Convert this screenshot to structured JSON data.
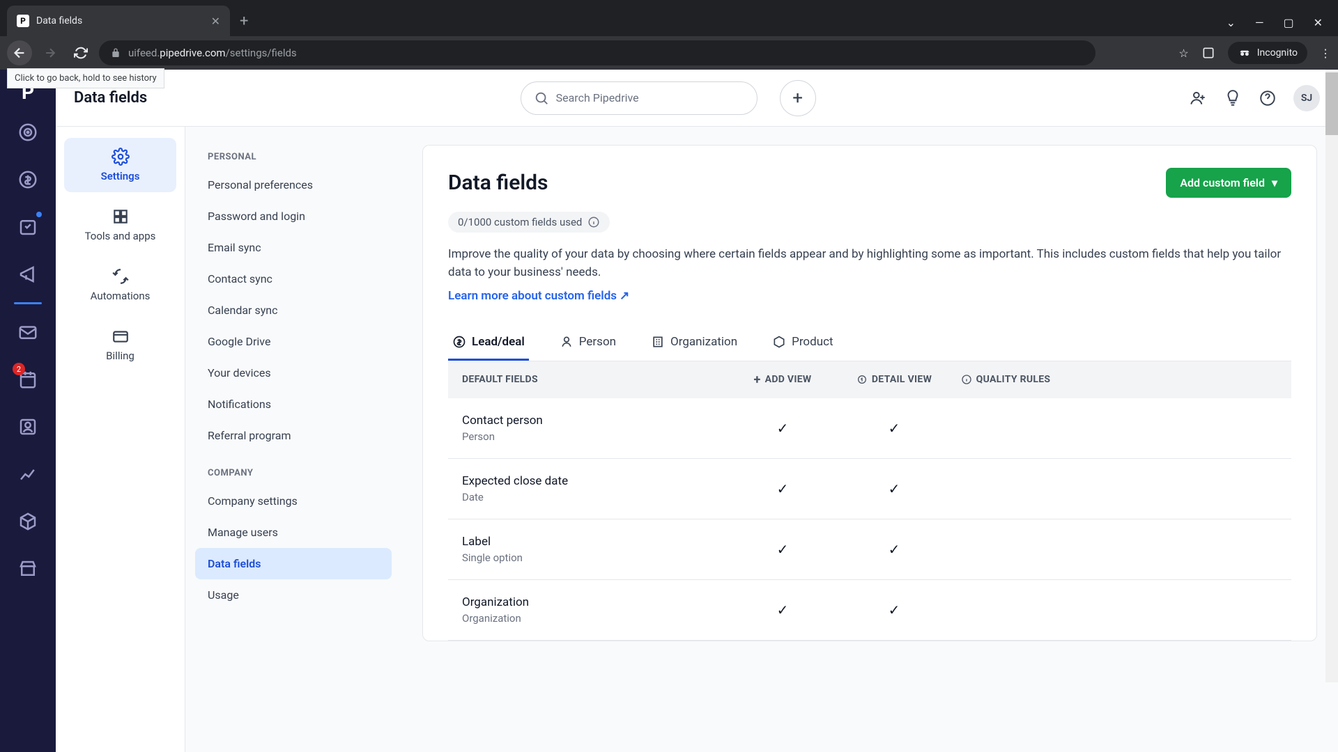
{
  "browser": {
    "tab_title": "Data fields",
    "favicon_letter": "P",
    "url_prefix": "uifeed.",
    "url_domain": "pipedrive.com",
    "url_path": "/settings/fields",
    "incognito_label": "Incognito",
    "back_tooltip": "Click to go back, hold to see history"
  },
  "appbar": {
    "title": "Data fields",
    "search_placeholder": "Search Pipedrive",
    "avatar_initials": "SJ"
  },
  "leftrail": {
    "badge_count": "2"
  },
  "settings_nav": {
    "items": [
      {
        "label": "Settings",
        "active": true
      },
      {
        "label": "Tools and apps"
      },
      {
        "label": "Automations"
      },
      {
        "label": "Billing"
      }
    ]
  },
  "submenu": {
    "section1_title": "PERSONAL",
    "section1_items": [
      "Personal preferences",
      "Password and login",
      "Email sync",
      "Contact sync",
      "Calendar sync",
      "Google Drive",
      "Your devices",
      "Notifications",
      "Referral program"
    ],
    "section2_title": "COMPANY",
    "section2_items": [
      "Company settings",
      "Manage users",
      "Data fields",
      "Usage"
    ],
    "active_item": "Data fields"
  },
  "content": {
    "title": "Data fields",
    "add_button": "Add custom field",
    "usage_text": "0/1000 custom fields used",
    "description": "Improve the quality of your data by choosing where certain fields appear and by highlighting some as important. This includes custom fields that help you tailor data to your business' needs.",
    "learn_more": "Learn more about custom fields",
    "tabs": [
      "Lead/deal",
      "Person",
      "Organization",
      "Product"
    ],
    "active_tab": "Lead/deal",
    "table_header": {
      "c1": "DEFAULT FIELDS",
      "c2": "ADD VIEW",
      "c3": "DETAIL VIEW",
      "c4": "QUALITY RULES"
    },
    "rows": [
      {
        "name": "Contact person",
        "type": "Person",
        "add": true,
        "detail": true
      },
      {
        "name": "Expected close date",
        "type": "Date",
        "add": true,
        "detail": true
      },
      {
        "name": "Label",
        "type": "Single option",
        "add": true,
        "detail": true
      },
      {
        "name": "Organization",
        "type": "Organization",
        "add": true,
        "detail": true
      }
    ]
  }
}
